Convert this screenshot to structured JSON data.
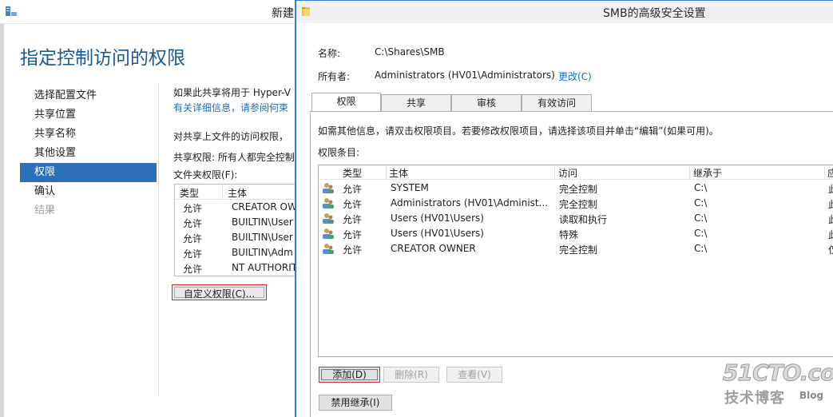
{
  "wizard": {
    "title": "新建",
    "heading": "指定控制访问的权限",
    "steps": [
      "选择配置文件",
      "共享位置",
      "共享名称",
      "其他设置",
      "权限",
      "确认",
      "结果"
    ],
    "active_step": 4,
    "text1": "如果此共享将用于 Hyper-V",
    "link1": "有关详细信息，请参阅何束",
    "text2": "对共享上文件的访问权限，",
    "text3": "共享权限: 所有人都完全控制",
    "text4": "文件夹权限(F):",
    "table": {
      "headers": [
        "类型",
        "主体"
      ],
      "rows": [
        [
          "允许",
          "CREATOR OW"
        ],
        [
          "允许",
          "BUILTIN\\User"
        ],
        [
          "允许",
          "BUILTIN\\User"
        ],
        [
          "允许",
          "BUILTIN\\Adm"
        ],
        [
          "允许",
          "NT AUTHORIT"
        ]
      ]
    },
    "custom_button": "自定义权限(C)..."
  },
  "dialog": {
    "title": "SMB的高级安全设置",
    "name_label": "名称:",
    "name_value": "C:\\Shares\\SMB",
    "owner_label": "所有者:",
    "owner_value": "Administrators (HV01\\Administrators)",
    "change_link": "更改(C)",
    "tabs": [
      "权限",
      "共享",
      "审核",
      "有效访问"
    ],
    "active_tab": 0,
    "info_text": "如需其他信息，请双击权限项目。若要修改权限项目，请选择该项目并单击“编辑”(如果可用)。",
    "entries_label": "权限条目:",
    "columns": [
      "类型",
      "主体",
      "访问",
      "继承于",
      "应"
    ],
    "rows": [
      {
        "type": "允许",
        "principal": "SYSTEM",
        "access": "完全控制",
        "inherited": "C:\\",
        "applies": "此"
      },
      {
        "type": "允许",
        "principal": "Administrators (HV01\\Administ...",
        "access": "完全控制",
        "inherited": "C:\\",
        "applies": "此"
      },
      {
        "type": "允许",
        "principal": "Users (HV01\\Users)",
        "access": "读取和执行",
        "inherited": "C:\\",
        "applies": "此"
      },
      {
        "type": "允许",
        "principal": "Users (HV01\\Users)",
        "access": "特殊",
        "inherited": "C:\\",
        "applies": "此"
      },
      {
        "type": "允许",
        "principal": "CREATOR OWNER",
        "access": "完全控制",
        "inherited": "C:\\",
        "applies": "仅"
      }
    ],
    "buttons": {
      "add": "添加(D)",
      "remove": "删除(R)",
      "view": "查看(V)",
      "disable_inheritance": "禁用继承(I)"
    }
  },
  "watermark": {
    "line1": "51CTO.com",
    "line2": "技术博客",
    "line3": "Blog"
  },
  "colors": {
    "accent": "#2e6db7",
    "heading": "#1b5a8f",
    "link": "#1b6ac9",
    "highlight": "#d42c2c"
  }
}
